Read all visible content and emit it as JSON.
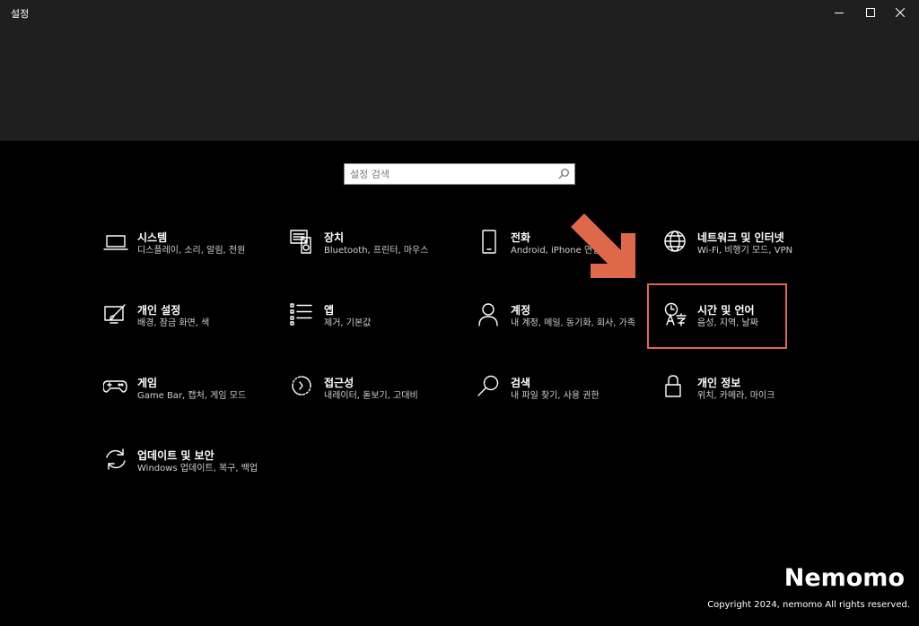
{
  "window": {
    "title": "설정"
  },
  "search": {
    "placeholder": "설정 검색"
  },
  "tiles": [
    {
      "title": "시스템",
      "desc": "디스플레이, 소리, 알림, 전원"
    },
    {
      "title": "장치",
      "desc": "Bluetooth, 프린터, 마우스"
    },
    {
      "title": "전화",
      "desc": "Android, iPhone 연결"
    },
    {
      "title": "네트워크 및 인터넷",
      "desc": "Wi-Fi, 비행기 모드, VPN"
    },
    {
      "title": "개인 설정",
      "desc": "배경, 잠금 화면, 색"
    },
    {
      "title": "앱",
      "desc": "제거, 기본값"
    },
    {
      "title": "계정",
      "desc": "내 계정, 메일, 동기화, 회사, 가족"
    },
    {
      "title": "시간 및 언어",
      "desc": "음성, 지역, 날짜"
    },
    {
      "title": "게임",
      "desc": "Game Bar, 캡처, 게임 모드"
    },
    {
      "title": "접근성",
      "desc": "내레이터, 돋보기, 고대비"
    },
    {
      "title": "검색",
      "desc": "내 파일 찾기, 사용 권한"
    },
    {
      "title": "개인 정보",
      "desc": "위치, 카메라, 마이크"
    },
    {
      "title": "업데이트 및 보안",
      "desc": "Windows 업데이트, 복구, 백업"
    }
  ],
  "watermark": {
    "name": "Nemomo",
    "copyright": "Copyright 2024, nemomo All rights reserved."
  },
  "colors": {
    "highlight": "#e0684a",
    "background": "#000000",
    "titlebar": "#1f1f1f"
  }
}
